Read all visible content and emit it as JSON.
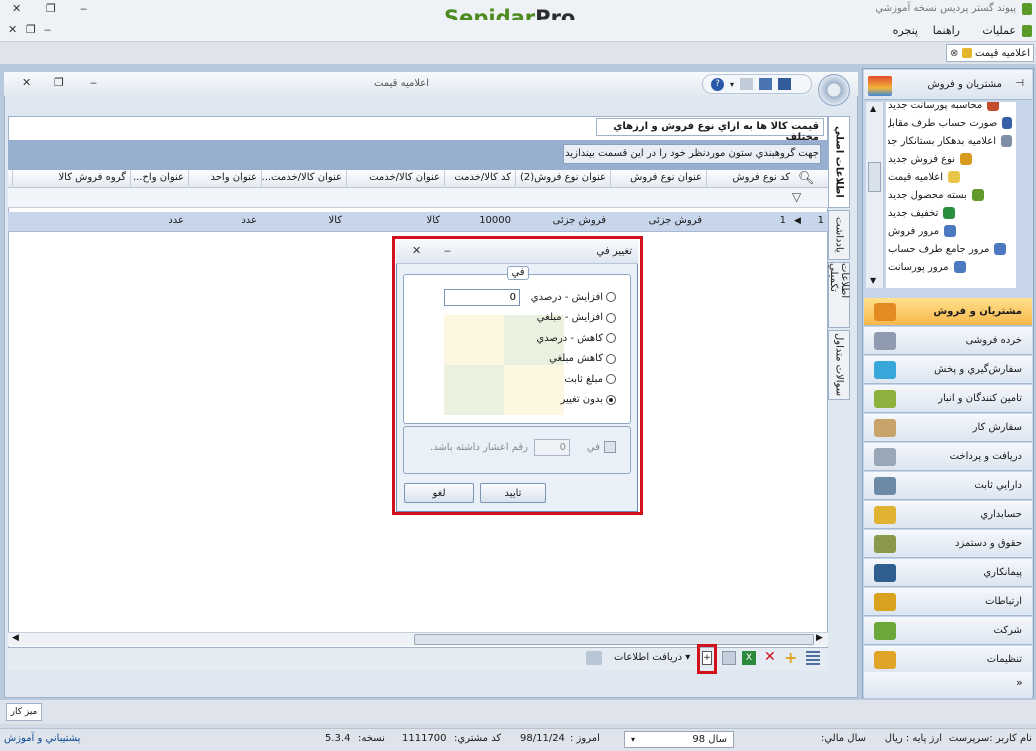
{
  "app": {
    "title": "پیوند گستر پردیس نسخه آموزشي",
    "logo_main": "Sepidar",
    "logo_suffix": "Pro"
  },
  "menu": {
    "operations": "عمليات",
    "help": "راهنما",
    "window": "پنجره"
  },
  "doc_tab": {
    "label": "اعلاميه قيمت"
  },
  "window": {
    "title": "اعلاميه قيمت"
  },
  "nav": {
    "header": "مشتريان و فروش",
    "items": [
      {
        "label": "محاسبه پورسانت جديد",
        "color": "#c44b2b"
      },
      {
        "label": "صورت حساب طرف مقابل جديد",
        "color": "#3560a8"
      },
      {
        "label": "اعلاميه بدهکار بستانکار جديد",
        "color": "#7f8fa8"
      },
      {
        "label": "نوع فروش جديد",
        "color": "#d79a1f"
      },
      {
        "label": "اعلاميه قيمت",
        "color": "#e8c64a"
      },
      {
        "label": "بسته محصول جديد",
        "color": "#5f9a2a"
      },
      {
        "label": "تخفيف جديد",
        "color": "#2a8f3c"
      },
      {
        "label": "مرور فروش",
        "color": "#4b78c0"
      },
      {
        "label": "مرور جامع طرف حساب",
        "color": "#4b78c0"
      },
      {
        "label": "مرور پورسانت",
        "color": "#4b78c0"
      }
    ],
    "categories": [
      {
        "label": "مشتريان و فروش",
        "color": "#e38a22",
        "active": true
      },
      {
        "label": "خرده فروشی",
        "color": "#8f9bb0",
        "active": false
      },
      {
        "label": "سفارش‌گيري و پخش",
        "color": "#37a6d8",
        "active": false
      },
      {
        "label": "تامين کنندگان و انبار",
        "color": "#8cb13c",
        "active": false
      },
      {
        "label": "سفارش کار",
        "color": "#c8a36a",
        "active": false
      },
      {
        "label": "دريافت و پرداخت",
        "color": "#9aa7b8",
        "active": false
      },
      {
        "label": "دارايي ثابت",
        "color": "#6c8aa6",
        "active": false
      },
      {
        "label": "حسابداري",
        "color": "#e0b432",
        "active": false
      },
      {
        "label": "حقوق و دستمزد",
        "color": "#8a9a4a",
        "active": false
      },
      {
        "label": "پيمانکاري",
        "color": "#2f5f8f",
        "active": false
      },
      {
        "label": "ارتباطات",
        "color": "#d8a21e",
        "active": false
      },
      {
        "label": "شرکت",
        "color": "#6aa83a",
        "active": false
      },
      {
        "label": "تنظيمات",
        "color": "#e0a526",
        "active": false
      }
    ]
  },
  "side_tabs": [
    "اطلاعات اصلي",
    "يادداشت",
    "اطلاعات تکميلي",
    "سوالات متداول"
  ],
  "subject": "قيمت کالا ها به ازاي نوع فروش و ارزهاي مختلف",
  "group_hint": "جهت گروهبندي ستون موردنظر خود را در اين قسمت بيندازيد",
  "grid": {
    "columns": [
      "کد نوع فروش",
      "عنوان نوع فروش",
      "عنوان نوع فروش(2)",
      "کد کالا/خدمت",
      "عنوان کالا/خدمت",
      "عنوان کالا/خدمت...",
      "عنوان واحد",
      "عنوان واح...",
      "گروه فروش کالا"
    ],
    "row": {
      "rownum": "1",
      "sale_code": "1",
      "sale_title": "فروش جزئی",
      "sale_title2": "فروش جزئی",
      "item_code": "10000",
      "item_title": "کالا",
      "item_title2": "کالا",
      "unit": "عدد",
      "unit2": "عدد"
    }
  },
  "toolbar": {
    "receive_info": "دريافت اطلاعات"
  },
  "dialog": {
    "title": "تغيير في",
    "group_label": "في",
    "options": [
      {
        "label": "افزايش - درصدي",
        "selected": false
      },
      {
        "label": "افزايش - مبلغي",
        "selected": false
      },
      {
        "label": "کاهش - درصدي",
        "selected": false
      },
      {
        "label": "کاهش مبلغي",
        "selected": false
      },
      {
        "label": "مبلغ ثابت",
        "selected": false
      },
      {
        "label": "بدون تغيير",
        "selected": true
      }
    ],
    "amount_value": "0",
    "decimal_label_pre": "في",
    "decimal_value": "0",
    "decimal_label_post": "رقم اعشار داشته باشد.",
    "ok": "تاييد",
    "cancel": "لغو"
  },
  "desktop": {
    "label": "ميز کار"
  },
  "status": {
    "user": "نام کاربر :سرپرست",
    "currency": "ارز پايه : ريال",
    "fiscal_year_label": "سال مالي:",
    "fiscal_year": "سال 98",
    "today_label": "امروز :",
    "today": "98/11/24",
    "customer_code_label": "کد مشتري:",
    "customer_code": "1111700",
    "version_label": "نسخه:",
    "version": "5.3.4",
    "support": "پشتيباني و آموزش"
  }
}
